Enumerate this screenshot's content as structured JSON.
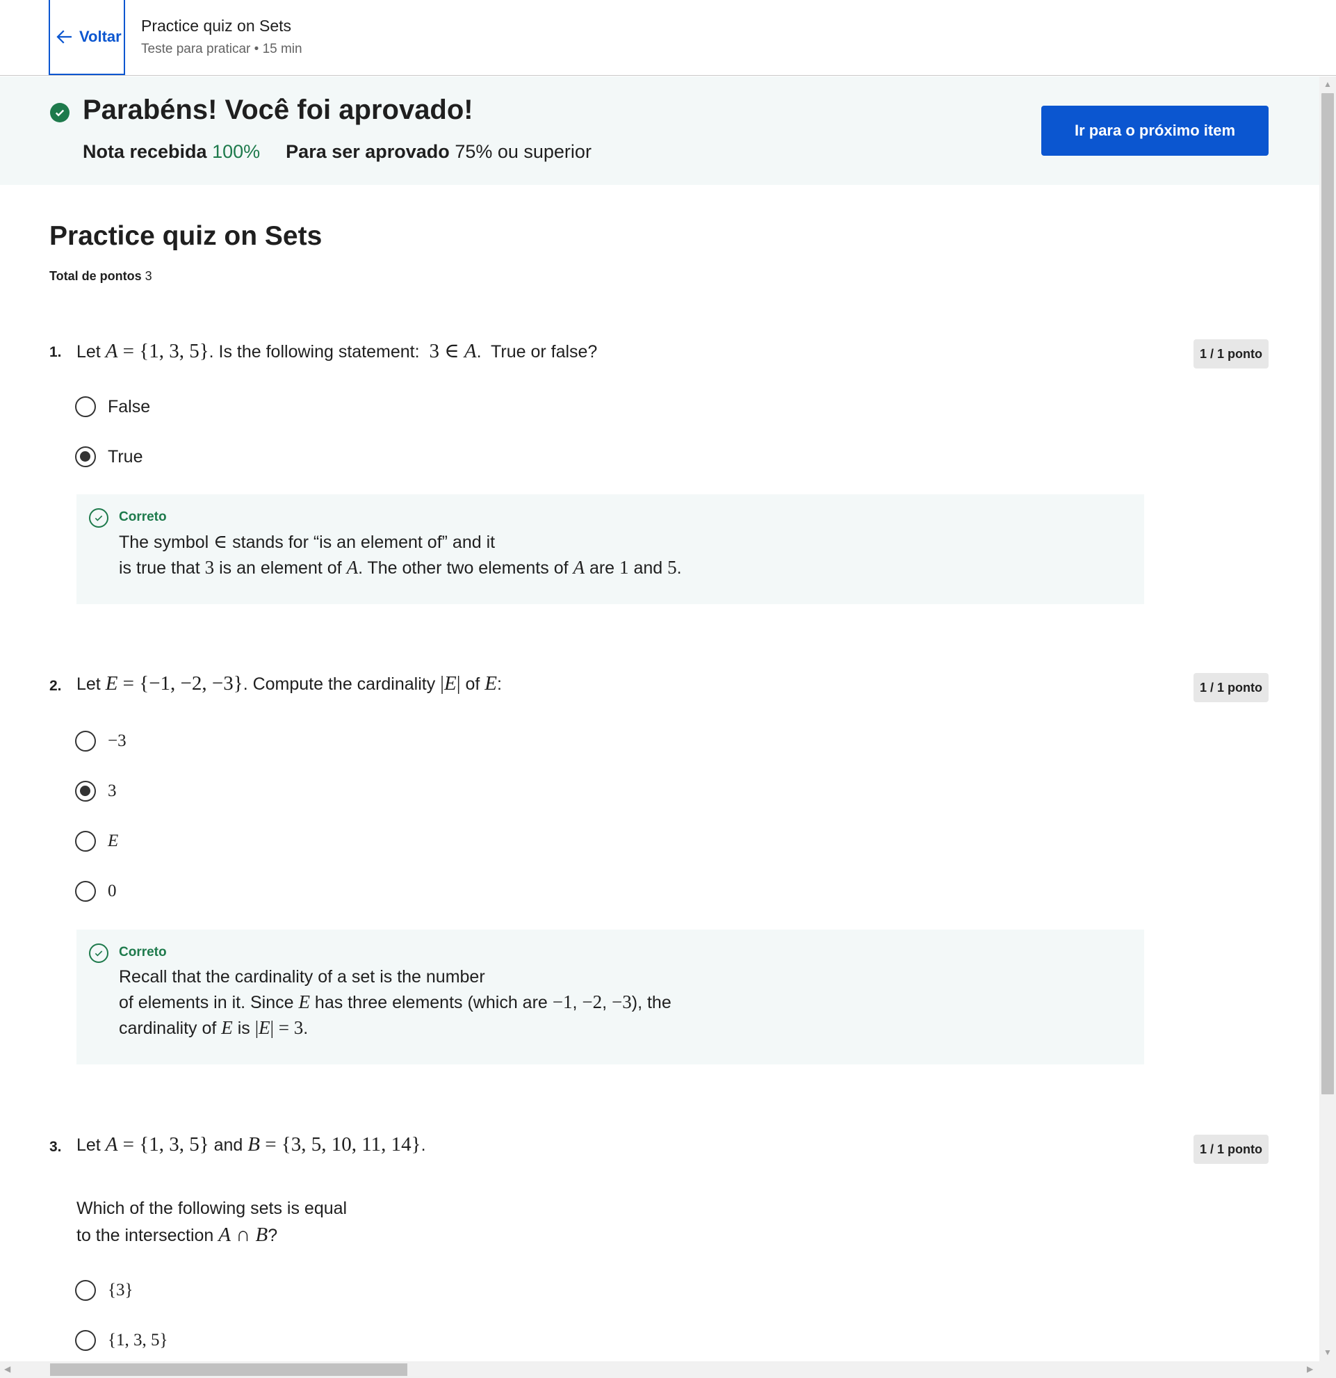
{
  "header": {
    "back_label": "Voltar",
    "title": "Practice quiz on Sets",
    "subtitle": "Teste para praticar • 15 min"
  },
  "banner": {
    "title": "Parabéns! Você foi aprovado!",
    "grade_label": "Nota recebida",
    "grade_value": "100%",
    "pass_label": "Para ser aprovado",
    "pass_value": "75% ou superior",
    "next_button": "Ir para o próximo item"
  },
  "quiz": {
    "title": "Practice quiz on Sets",
    "total_label": "Total de pontos",
    "total_value": "3"
  },
  "questions": [
    {
      "number": "1.",
      "points": "1 / 1 ponto",
      "options": [
        {
          "label": "False",
          "selected": false
        },
        {
          "label": "True",
          "selected": true
        }
      ],
      "feedback_label": "Correto"
    },
    {
      "number": "2.",
      "points": "1 / 1 ponto",
      "options": [
        {
          "label": "−3",
          "selected": false
        },
        {
          "label": "3",
          "selected": true
        },
        {
          "label": "E",
          "selected": false
        },
        {
          "label": "0",
          "selected": false
        }
      ],
      "feedback_label": "Correto"
    },
    {
      "number": "3.",
      "points": "1 / 1 ponto",
      "prompt_line1": "Which of the following sets is equal",
      "options": [
        {
          "label": "{3}",
          "selected": false
        },
        {
          "label": "{1, 3, 5}",
          "selected": false
        }
      ]
    }
  ]
}
